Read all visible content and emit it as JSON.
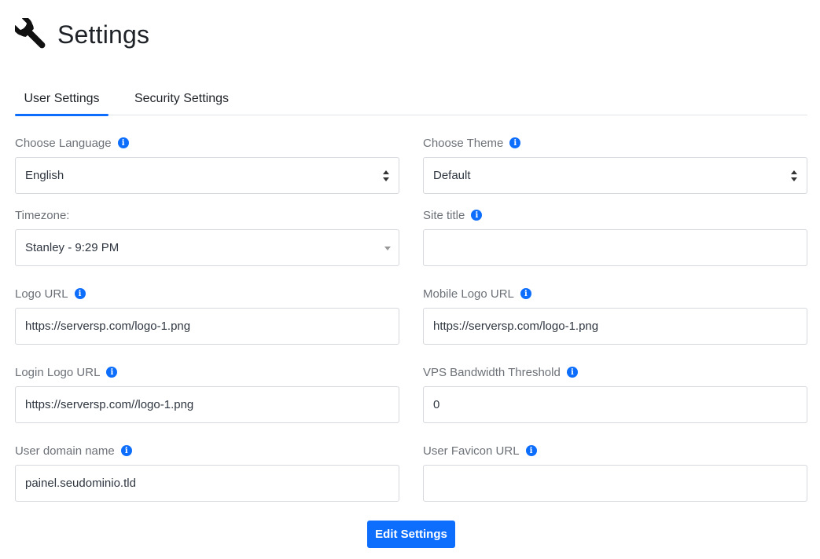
{
  "header": {
    "title": "Settings",
    "icon": "wrench-icon"
  },
  "tabs": [
    {
      "label": "User Settings",
      "active": true
    },
    {
      "label": "Security Settings",
      "active": false
    }
  ],
  "fields": {
    "language": {
      "label": "Choose Language",
      "value": "English"
    },
    "theme": {
      "label": "Choose Theme",
      "value": "Default"
    },
    "timezone": {
      "label": "Timezone:",
      "value": "Stanley - 9:29 PM"
    },
    "site_title": {
      "label": "Site title",
      "value": ""
    },
    "logo_url": {
      "label": "Logo URL",
      "value": "https://serversp.com/logo-1.png"
    },
    "mobile_logo_url": {
      "label": "Mobile Logo URL",
      "value": "https://serversp.com/logo-1.png"
    },
    "login_logo_url": {
      "label": "Login Logo URL",
      "value": "https://serversp.com//logo-1.png"
    },
    "vps_bandwidth_threshold": {
      "label": "VPS Bandwidth Threshold",
      "value": "0"
    },
    "user_domain_name": {
      "label": "User domain name",
      "value": "painel.seudominio.tld"
    },
    "user_favicon_url": {
      "label": "User Favicon URL",
      "value": ""
    }
  },
  "submit": {
    "label": "Edit Settings"
  },
  "colors": {
    "accent": "#0d6efd",
    "border": "#d5d8dc",
    "label": "#6c7178"
  }
}
